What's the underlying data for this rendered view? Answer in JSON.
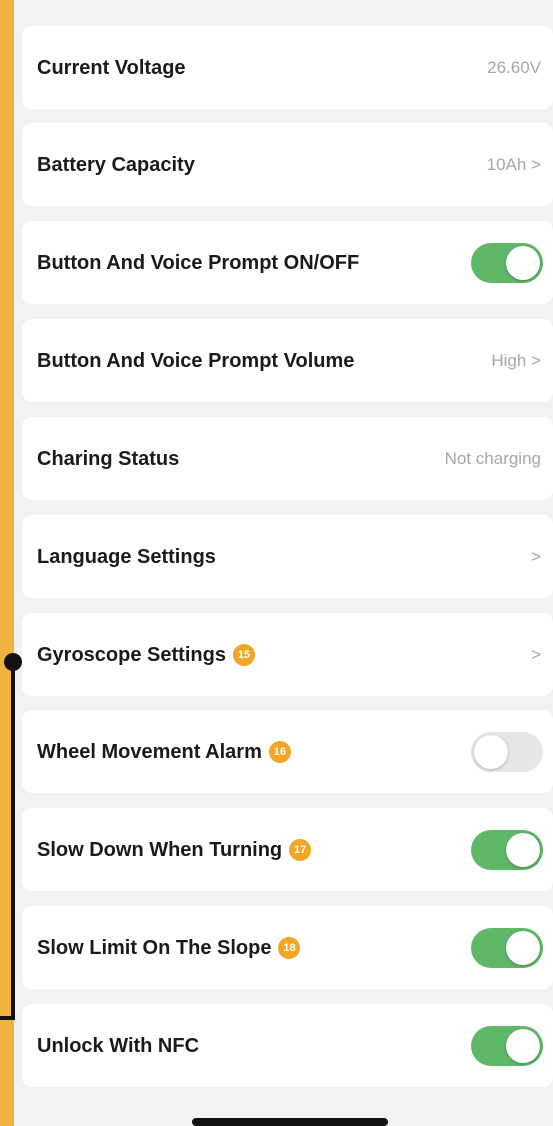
{
  "settings": [
    {
      "label": "Current Voltage",
      "value": "26.60V"
    },
    {
      "label": "Battery Capacity",
      "value": "10Ah >"
    },
    {
      "label": "Button And Voice Prompt ON/OFF",
      "toggle": "on"
    },
    {
      "label": "Button And Voice Prompt Volume",
      "value": "High >"
    },
    {
      "label": "Charing Status",
      "value": "Not charging"
    },
    {
      "label": "Language Settings",
      "value": ">"
    },
    {
      "label": "Gyroscope Settings",
      "badge": "15",
      "value": ">"
    },
    {
      "label": "Wheel Movement Alarm",
      "badge": "16",
      "toggle": "off"
    },
    {
      "label": "Slow Down When Turning",
      "badge": "17",
      "toggle": "on"
    },
    {
      "label": "Slow Limit On The Slope",
      "badge": "18",
      "toggle": "on"
    },
    {
      "label": "Unlock With NFC",
      "toggle": "on"
    }
  ],
  "colors": {
    "frame": "#f0b33d",
    "toggle_on": "#5fb868",
    "toggle_off": "#e6e6e8",
    "badge": "#f2a623"
  }
}
